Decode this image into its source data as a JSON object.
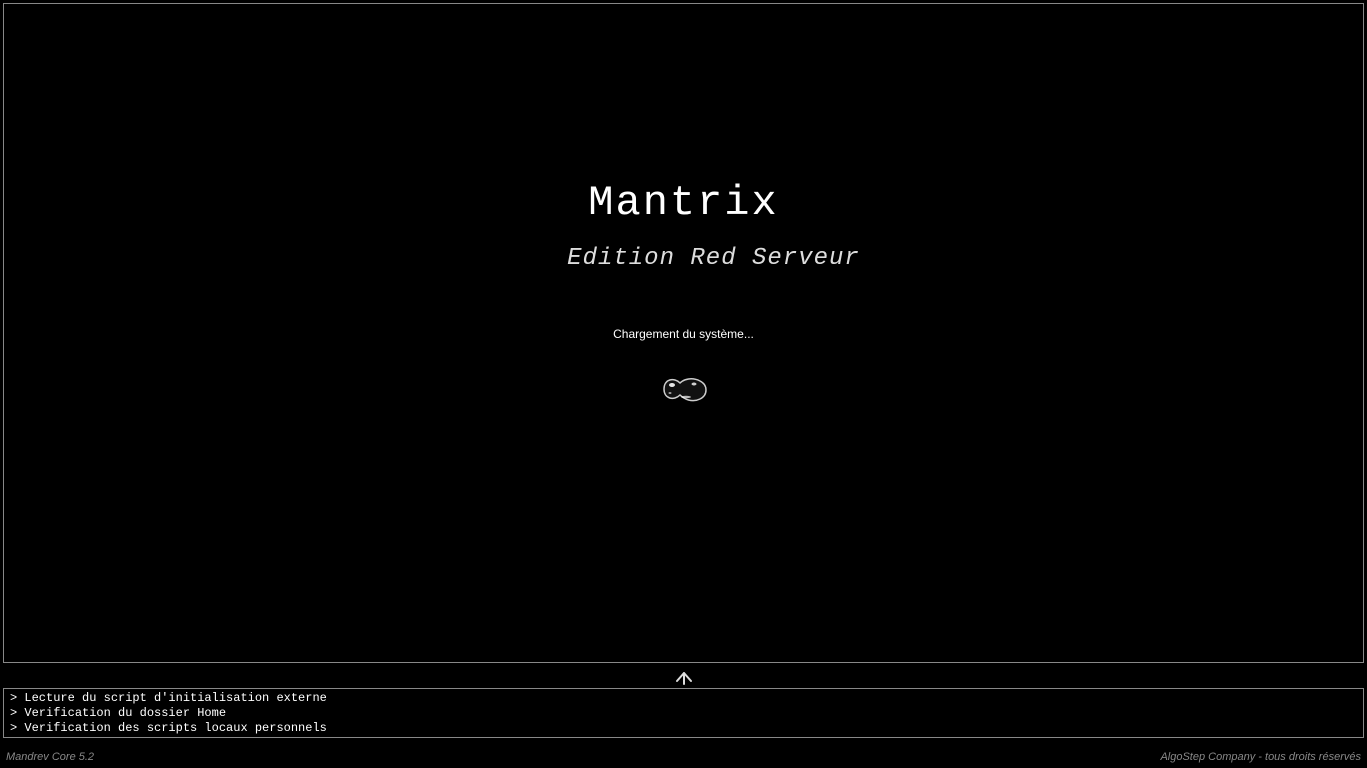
{
  "splash": {
    "title": "Mantrix",
    "subtitle": "Edition Red Serveur",
    "loading_label": "Chargement du système..."
  },
  "log": {
    "prompt": "> ",
    "lines": [
      "Lecture du script d'initialisation externe",
      "Verification du dossier Home",
      "Verification des scripts locaux personnels"
    ]
  },
  "footer": {
    "left": "Mandrev Core 5.2",
    "right": "AlgoStep Company - tous droits réservés"
  }
}
